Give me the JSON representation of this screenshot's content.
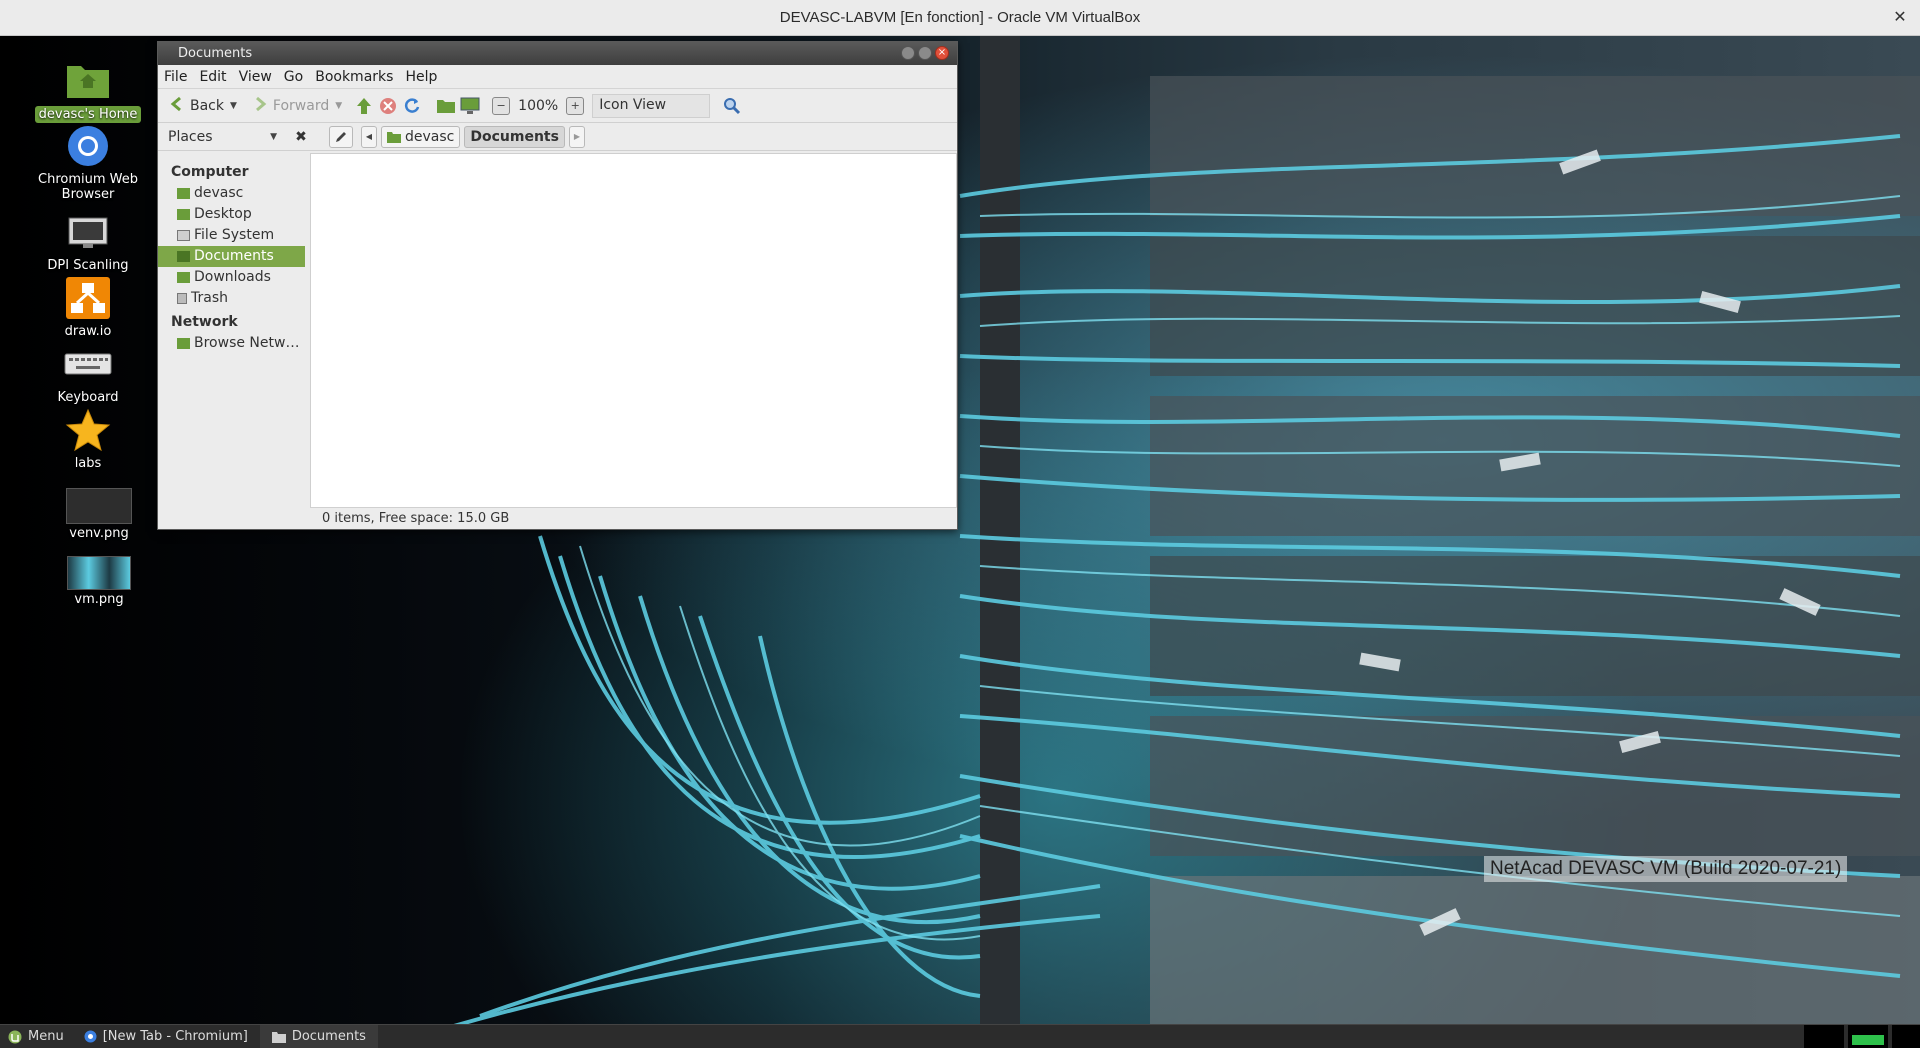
{
  "host": {
    "title": "DEVASC-LABVM [En fonction] - Oracle VM VirtualBox",
    "close_glyph": "✕"
  },
  "desktop": {
    "icons": [
      {
        "label": "devasc's Home",
        "icon": "home-folder-icon"
      },
      {
        "label": "Chromium Web Browser",
        "icon": "chromium-icon"
      },
      {
        "label": "DPI Scanling",
        "icon": "monitor-icon"
      },
      {
        "label": "draw.io",
        "icon": "drawio-icon"
      },
      {
        "label": "Keyboard",
        "icon": "keyboard-icon"
      },
      {
        "label": "labs",
        "icon": "star-icon"
      },
      {
        "label": "venv.png",
        "icon": "image-thumbnail-icon"
      },
      {
        "label": "vm.png",
        "icon": "image-thumbnail-icon"
      }
    ],
    "watermark": "NetAcad DEVASC VM (Build 2020-07-21)"
  },
  "file_manager": {
    "title": "Documents",
    "menu": [
      "File",
      "Edit",
      "View",
      "Go",
      "Bookmarks",
      "Help"
    ],
    "toolbar": {
      "back_label": "Back",
      "forward_label": "Forward",
      "zoom_level": "100%",
      "view_mode": "Icon View"
    },
    "places_label": "Places",
    "breadcrumb": [
      "devasc",
      "Documents"
    ],
    "sidebar": {
      "computer_heading": "Computer",
      "computer_items": [
        "devasc",
        "Desktop",
        "File System",
        "Documents",
        "Downloads",
        "Trash"
      ],
      "network_heading": "Network",
      "network_items": [
        "Browse Netw…"
      ],
      "selected": "Documents"
    },
    "status": "0 items, Free space: 15.0 GB"
  },
  "taskbar": {
    "menu_label": "Menu",
    "tasks": [
      "[New Tab - Chromium]",
      "Documents"
    ]
  },
  "colors": {
    "accent_green": "#7ea748",
    "close_red": "#e0503a",
    "cable_cyan": "#5ccbe0"
  }
}
